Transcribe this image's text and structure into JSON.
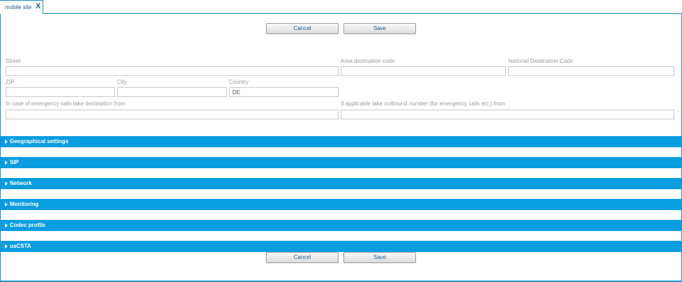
{
  "tab": {
    "label": "mobile site",
    "close": "X"
  },
  "actions": {
    "cancel": "Cancel",
    "save": "Save"
  },
  "form": {
    "street": {
      "label": "Street",
      "value": ""
    },
    "area_code": {
      "label": "Area destination code",
      "value": ""
    },
    "national_code": {
      "label": "National Destination Code",
      "value": ""
    },
    "zip": {
      "label": "ZIP",
      "value": ""
    },
    "city": {
      "label": "City",
      "value": ""
    },
    "country": {
      "label": "Country",
      "value": "DE"
    },
    "emergency_dest": {
      "label": "In case of emergency calls take destination from",
      "value": ""
    },
    "outbound_number": {
      "label": "If applicable take outbound number (for emergency calls etc.) from",
      "value": ""
    }
  },
  "sections": [
    {
      "label": "Geographical settings"
    },
    {
      "label": "SIP"
    },
    {
      "label": "Network"
    },
    {
      "label": "Monitoring"
    },
    {
      "label": "Codec profile"
    },
    {
      "label": "uaCSTA"
    }
  ],
  "colors": {
    "accent": "#0a9de0",
    "border": "#1a8fd0",
    "link_text": "#1f5e8c"
  }
}
